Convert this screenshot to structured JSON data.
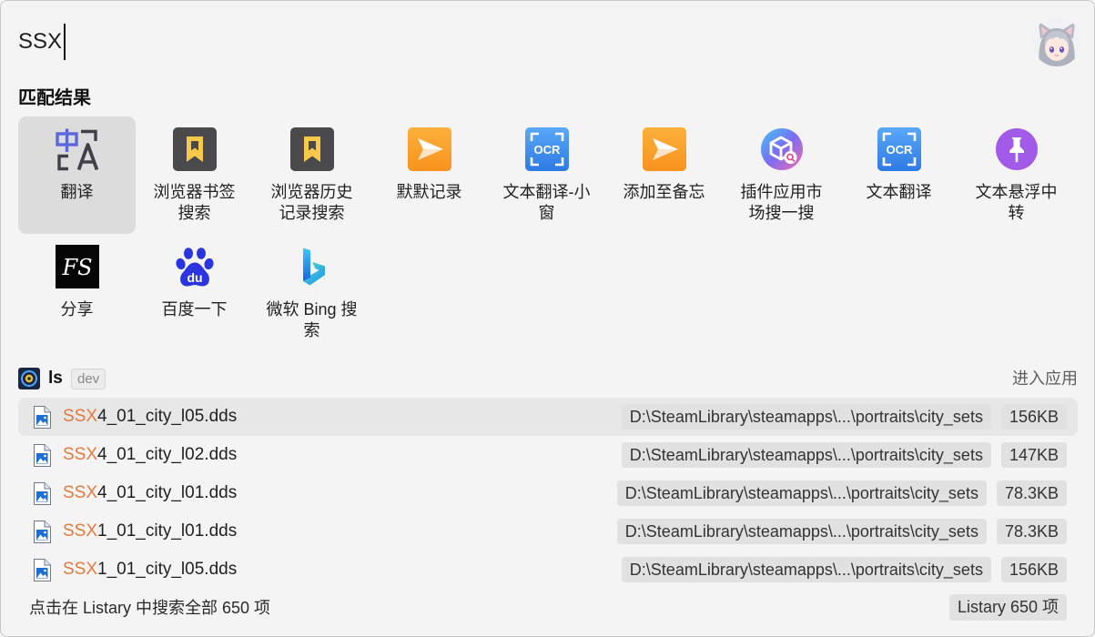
{
  "search": {
    "value": "SSX"
  },
  "avatar": {
    "icon": "avatar-icon"
  },
  "matches": {
    "heading": "匹配结果",
    "items": [
      {
        "label": "翻译",
        "icon": "translate-icon",
        "selected": true
      },
      {
        "label": "浏览器书签搜索",
        "icon": "bookmark-icon"
      },
      {
        "label": "浏览器历史记录搜索",
        "icon": "bookmark-icon"
      },
      {
        "label": "默默记录",
        "icon": "paper-plane-icon"
      },
      {
        "label": "文本翻译-小窗",
        "icon": "ocr-icon",
        "icon_text": "OCR"
      },
      {
        "label": "添加至备忘",
        "icon": "paper-plane-icon"
      },
      {
        "label": "插件应用市场搜一搜",
        "icon": "plugin-market-icon"
      },
      {
        "label": "文本翻译",
        "icon": "ocr-icon",
        "icon_text": "OCR"
      },
      {
        "label": "文本悬浮中转",
        "icon": "pin-icon"
      },
      {
        "label": "分享",
        "icon": "fs-share-icon",
        "icon_text": "FS"
      },
      {
        "label": "百度一下",
        "icon": "baidu-icon",
        "icon_text": "du"
      },
      {
        "label": "微软 Bing 搜索",
        "icon": "bing-icon"
      }
    ]
  },
  "plugin": {
    "name": "ls",
    "badge": "dev",
    "enter_label": "进入应用",
    "icon": "ls-plugin-icon"
  },
  "files": [
    {
      "match": "SSX",
      "rest": "4_01_city_l05.dds",
      "path": "D:\\SteamLibrary\\steamapps\\...\\portraits\\city_sets",
      "size": "156KB",
      "selected": true,
      "icon": "image-file-icon"
    },
    {
      "match": "SSX",
      "rest": "4_01_city_l02.dds",
      "path": "D:\\SteamLibrary\\steamapps\\...\\portraits\\city_sets",
      "size": "147KB",
      "icon": "image-file-icon"
    },
    {
      "match": "SSX",
      "rest": "4_01_city_l01.dds",
      "path": "D:\\SteamLibrary\\steamapps\\...\\portraits\\city_sets",
      "size": "78.3KB",
      "icon": "image-file-icon"
    },
    {
      "match": "SSX",
      "rest": "1_01_city_l01.dds",
      "path": "D:\\SteamLibrary\\steamapps\\...\\portraits\\city_sets",
      "size": "78.3KB",
      "icon": "image-file-icon"
    },
    {
      "match": "SSX",
      "rest": "1_01_city_l05.dds",
      "path": "D:\\SteamLibrary\\steamapps\\...\\portraits\\city_sets",
      "size": "156KB",
      "icon": "image-file-icon"
    }
  ],
  "footer": {
    "text": "点击在 Listary 中搜索全部 650 项",
    "badge": "Listary 650 项"
  },
  "colors": {
    "match_highlight": "#e9783a",
    "selected_item_bg": "#dcdcdc",
    "selected_row_bg": "#e7e7e7",
    "chip_bg": "#e1e1e1",
    "window_bg": "#f4f4f4"
  }
}
